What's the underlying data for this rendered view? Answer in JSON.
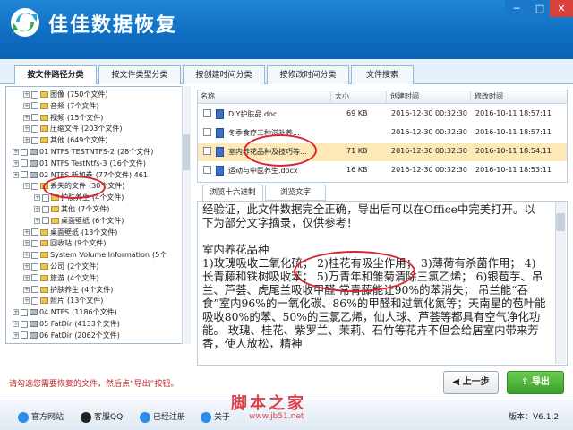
{
  "app": {
    "title": "佳佳数据恢复",
    "version_label": "版本：",
    "version": "V6.1.2"
  },
  "window": {
    "minimize": "─",
    "maximize": "□",
    "close": "✕"
  },
  "tabs": [
    "按文件路径分类",
    "按文件类型分类",
    "按创建时间分类",
    "按修改时间分类",
    "文件搜索"
  ],
  "tree": [
    {
      "label": "图像",
      "count": "(750个文件)",
      "indent": 1,
      "kind": "folder"
    },
    {
      "label": "音频",
      "count": "(7个文件)",
      "indent": 1,
      "kind": "folder"
    },
    {
      "label": "视频",
      "count": "(15个文件)",
      "indent": 1,
      "kind": "folder"
    },
    {
      "label": "压缩文件",
      "count": "(203个文件)",
      "indent": 1,
      "kind": "folder"
    },
    {
      "label": "其他",
      "count": "(649个文件)",
      "indent": 1,
      "kind": "folder"
    },
    {
      "label": "01 NTFS TESTNTFS-2",
      "count": "(28个文件)",
      "indent": 0,
      "kind": "drive"
    },
    {
      "label": "01 NTFS TestNtfs-3",
      "count": "(16个文件)",
      "indent": 0,
      "kind": "drive"
    },
    {
      "label": "02 NTFS 新加卷",
      "count": "(77个文件) 461",
      "indent": 0,
      "kind": "drive"
    },
    {
      "label": "丢失的文件",
      "count": "(30个文件)",
      "indent": 1,
      "kind": "folder"
    },
    {
      "label": "护肤养生",
      "count": "(4个文件)",
      "indent": 2,
      "kind": "folder"
    },
    {
      "label": "其他",
      "count": "(7个文件)",
      "indent": 2,
      "kind": "folder"
    },
    {
      "label": "桌面壁纸",
      "count": "(6个文件)",
      "indent": 2,
      "kind": "folder"
    },
    {
      "label": "桌面壁纸",
      "count": "(13个文件)",
      "indent": 1,
      "kind": "folder"
    },
    {
      "label": "回收站",
      "count": "(9个文件)",
      "indent": 1,
      "kind": "folder"
    },
    {
      "label": "System Volume Information",
      "count": "(5个",
      "indent": 1,
      "kind": "folder"
    },
    {
      "label": "公司",
      "count": "(2个文件)",
      "indent": 1,
      "kind": "folder"
    },
    {
      "label": "旅游",
      "count": "(4个文件)",
      "indent": 1,
      "kind": "folder"
    },
    {
      "label": "护肤养生",
      "count": "(4个文件)",
      "indent": 1,
      "kind": "folder"
    },
    {
      "label": "照片",
      "count": "(13个文件)",
      "indent": 1,
      "kind": "folder"
    },
    {
      "label": "04 NTFS",
      "count": "(1186个文件)",
      "indent": 0,
      "kind": "drive"
    },
    {
      "label": "05 FatDir",
      "count": "(4133个文件)",
      "indent": 0,
      "kind": "drive"
    },
    {
      "label": "06 FatDir",
      "count": "(2062个文件)",
      "indent": 0,
      "kind": "drive"
    }
  ],
  "files": {
    "columns": [
      "名称",
      "大小",
      "创建时间",
      "修改时间"
    ],
    "rows": [
      {
        "name": "DIY护肤品.doc",
        "size": "69 KB",
        "created": "2016-12-30  00:32:30",
        "modified": "2016-10-11  18:57:11"
      },
      {
        "name": "冬季食疗三种滋补养...",
        "size": "",
        "created": "2016-12-30  00:32:30",
        "modified": "2016-10-11  18:57:11"
      },
      {
        "name": "室内养花品种及技巧等...",
        "size": "71 KB",
        "created": "2016-12-30  00:32:30",
        "modified": "2016-10-11  18:54:11"
      },
      {
        "name": "运动与中医养生.docx",
        "size": "16 KB",
        "created": "2016-12-30  00:32:30",
        "modified": "2016-10-11  18:53:11"
      }
    ]
  },
  "preview": {
    "tabs": [
      "浏览十六进制",
      "浏览文字"
    ],
    "paragraphs": [
      "  经验证，此文件数据完全正确，导出后可以在Office中完美打开。以下为部分文字摘录，仅供参考！",
      "",
      "室内养花品种",
      "1)玫瑰吸收二氧化硫；  2)桂花有吸尘作用；  3)薄荷有杀菌作用；  4)长青藤和铁树吸收苯；  5)万青年和雏菊清除三氯乙烯；  6)银苞芋、吊兰、芦荟、虎尾兰吸收甲醛  常青藤能让90%的苯消失；  吊兰能“吞食”室内96%的一氧化碳、86%的甲醛和过氧化氮等；天南星的苞叶能吸收80%的苯、50%的三氯乙烯，仙人球、芦荟等都具有空气净化功能。  玫瑰、桂花、紫罗兰、茉莉、石竹等花卉不但会给居室内带来芳香，使人放松，精神"
    ]
  },
  "hint": "请勾选您需要恢复的文件，然后点“导出”按钮。",
  "buttons": {
    "prev": "上一步",
    "export": "导出"
  },
  "footer": {
    "links": [
      "官方网站",
      "客服QQ",
      "已经注册",
      "关于"
    ]
  },
  "watermark": {
    "text": "脚本之家",
    "url": "www.jb51.net"
  }
}
